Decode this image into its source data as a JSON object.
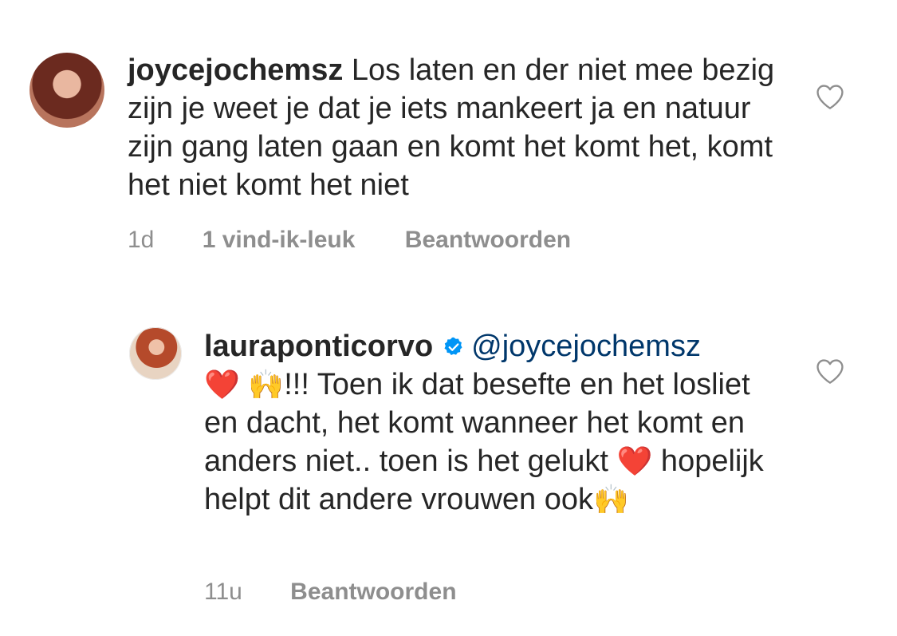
{
  "comments": [
    {
      "username": "joycejochemsz",
      "text": "Los laten en der niet mee bezig zijn je weet je dat je iets mankeert ja en natuur zijn gang laten gaan en komt het komt het, komt het niet komt het niet",
      "time": "1d",
      "likes": "1 vind-ik-leuk",
      "reply": "Beantwoorden",
      "avatar_icon": "profile-photo-avatar",
      "like_icon": "heart-outline-icon"
    },
    {
      "username": "lauraponticorvo",
      "verified_icon": "verified-badge-icon",
      "mention": "@joycejochemsz",
      "text_part1": "!!! Toen ik dat besefte en het losliet en dacht, het komt wanneer het komt en anders niet.. toen is het gelukt ",
      "text_part2": " hopelijk helpt dit andere vrouwen ook",
      "emoji_heart": "❤️",
      "emoji_hands": "🙌",
      "time": "11u",
      "reply": "Beantwoorden",
      "avatar_icon": "profile-photo-avatar",
      "like_icon": "heart-outline-icon"
    }
  ],
  "colors": {
    "text": "#262626",
    "meta": "#8e8e8e",
    "mention": "#00376b",
    "verified": "#0095f6"
  }
}
